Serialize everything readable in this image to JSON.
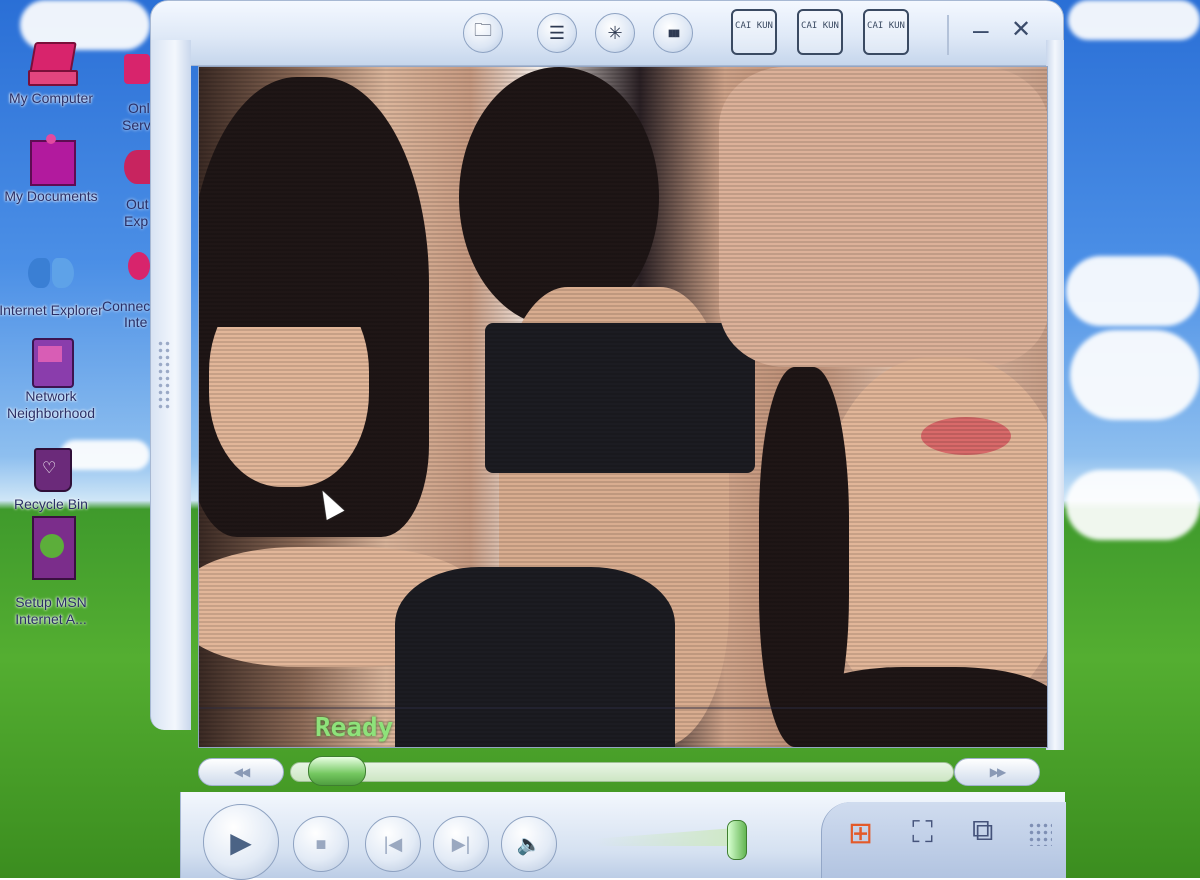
{
  "desktop": {
    "icons": [
      {
        "label": "My Computer",
        "icon": "laptop-icon",
        "color": "#d8246c"
      },
      {
        "label": "My Documents",
        "icon": "sticky-note-icon",
        "color": "#b21a9e"
      },
      {
        "label": "Internet Explorer",
        "icon": "butterfly-icon",
        "color": "#3a7fd4"
      },
      {
        "label": "Network Neighborhood",
        "icon": "arcade-icon",
        "color": "#8a3dac"
      },
      {
        "label": "Recycle Bin",
        "icon": "heart-bin-icon",
        "color": "#6b2a7a"
      },
      {
        "label": "Setup MSN Internet A...",
        "icon": "card-icon",
        "color": "#7b2d8b"
      }
    ],
    "clipped_labels": [
      "Onl",
      "Serv",
      "Out",
      "Exp",
      "Connec",
      "Inte"
    ]
  },
  "player": {
    "top_buttons": [
      {
        "name": "folder-icon",
        "glyph": "🗀"
      },
      {
        "name": "playlist-icon",
        "glyph": "☰"
      },
      {
        "name": "visualizer-icon",
        "glyph": "✳"
      },
      {
        "name": "equalizer-icon",
        "glyph": "▮▮▮"
      }
    ],
    "stamps": [
      "CAI KUN",
      "CAI KUN",
      "CAI KUN"
    ],
    "minimize_glyph": "–",
    "close_glyph": "✕",
    "status": "Ready",
    "seek": {
      "rewind_glyph": "◀◀",
      "forward_glyph": "▶▶",
      "position": 0.03
    },
    "controls": {
      "play_glyph": "▶",
      "stop_glyph": "■",
      "prev_glyph": "|◀",
      "next_glyph": "▶|",
      "mute_glyph": "🔈",
      "volume": 1.0
    },
    "tray": {
      "windows_glyph": "⊞",
      "fullscreen_glyph": "⛶",
      "skin_glyph": "⧉"
    },
    "colors": {
      "status_text": "#8ee27a",
      "accent_green": "#74c760",
      "chrome": "#dfe9f7"
    }
  }
}
